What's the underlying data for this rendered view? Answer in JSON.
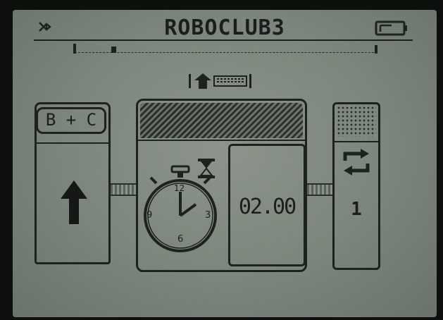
{
  "header": {
    "title": "ROBOCLUB3",
    "bluetooth_icon": "bluetooth-icon",
    "battery_icon": "battery-icon"
  },
  "blocks": {
    "motor": {
      "ports_label": "B + C",
      "direction_icon": "arrow-up-icon"
    },
    "wait": {
      "header_icon": "arrow-up-icon",
      "timer_icon": "stopwatch-icon",
      "hourglass_icon": "hourglass-icon",
      "duration": "02.00",
      "clock_numbers": [
        "12",
        "3",
        "6",
        "9"
      ]
    },
    "loop": {
      "icon": "loop-icon",
      "count": "1"
    }
  }
}
